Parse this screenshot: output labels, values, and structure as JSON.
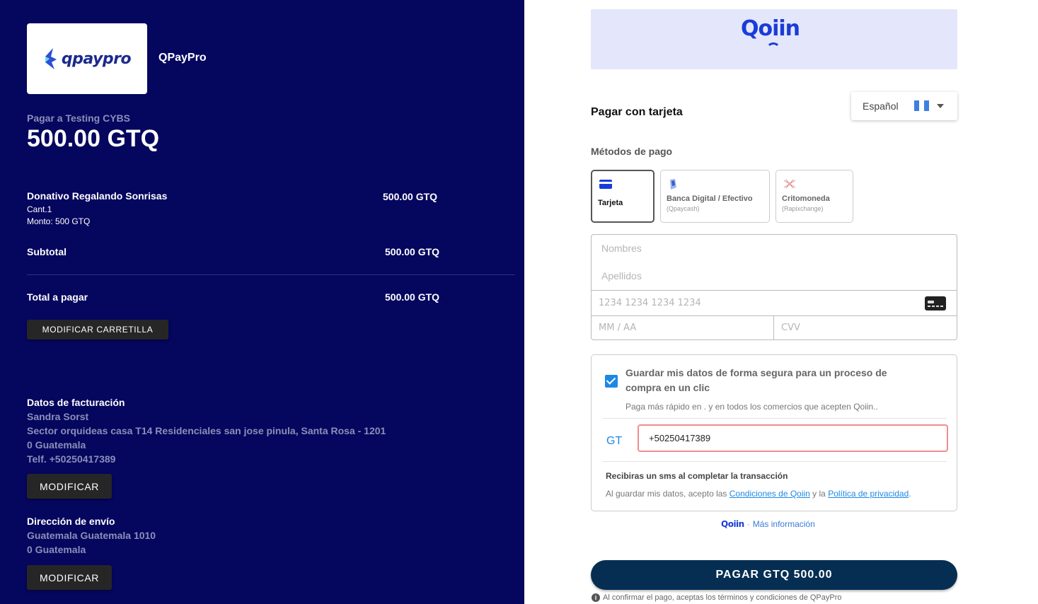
{
  "merchant": {
    "logo_text": "qpaypro",
    "name": "QPayPro",
    "pay_to": "Pagar a Testing CYBS",
    "amount": "500.00 GTQ"
  },
  "cart": {
    "item_name": "Donativo Regalando Sonrisas",
    "item_qty": "Cant.1",
    "item_monto": "Monto: 500  GTQ",
    "item_price": "500.00  GTQ",
    "subtotal_label": "Subtotal",
    "subtotal_value": "500.00 GTQ",
    "total_label": "Total a pagar",
    "total_value": "500.00 GTQ",
    "modify_cart_label": "MODIFICAR CARRETILLA"
  },
  "billing": {
    "title": "Datos de facturación",
    "name": "Sandra Sorst",
    "address": "Sector orquideas casa T14 Residenciales san jose pinula,  Santa Rosa - 1201",
    "country": "0 Guatemala",
    "phone": "Telf. +50250417389",
    "modify_label": "MODIFICAR"
  },
  "shipping": {
    "title": "Dirección de envío",
    "address": "Guatemala Guatemala 1010",
    "country": "0 Guatemala",
    "modify_label": "MODIFICAR"
  },
  "banner": {
    "logo_text": "Qoiin"
  },
  "payment": {
    "title": "Pagar con tarjeta",
    "language": "Español",
    "methods_title": "Métodos de pago",
    "methods": [
      {
        "label": "Tarjeta",
        "sub": "",
        "icon": "credit-card-icon"
      },
      {
        "label": "Banca Digital / Efectivo",
        "sub": "(Qpaycash)",
        "icon": "wallet-icon"
      },
      {
        "label": "Critomoneda",
        "sub": "(Rapixchange)",
        "icon": "crypto-icon"
      }
    ],
    "placeholders": {
      "first_name": "Nombres",
      "last_name": "Apellidos",
      "card_number": "1234 1234 1234 1234",
      "expiry": "MM / AA",
      "cvv": "CVV"
    }
  },
  "save": {
    "checked": true,
    "title": "Guardar mis datos de forma segura para un proceso de compra en un clic",
    "subtitle": "Paga más rápido en . y en todos los comercios que acepten Qoiin..",
    "country_code": "GT",
    "phone": "+50250417389",
    "sms_notice": "Recibiras un sms al completar la transacción",
    "terms_prefix": "Al guardar mis datos, acepto las ",
    "terms_link1": "Condiciones de Qoiin",
    "terms_mid": " y la ",
    "terms_link2": "Política de privacidad",
    "terms_suffix": "."
  },
  "more_info": {
    "logo_text": "Qoiin",
    "separator": "·",
    "link": "Más información"
  },
  "pay_button": "PAGAR GTQ 500.00",
  "footnote": "Al confirmar el pago, aceptas los términos y condiciones de QPayPro",
  "colors": {
    "left_bg": "#05065e",
    "pay_button": "#052e52",
    "accent": "#1e88e5",
    "brand": "#1a3cd8"
  }
}
